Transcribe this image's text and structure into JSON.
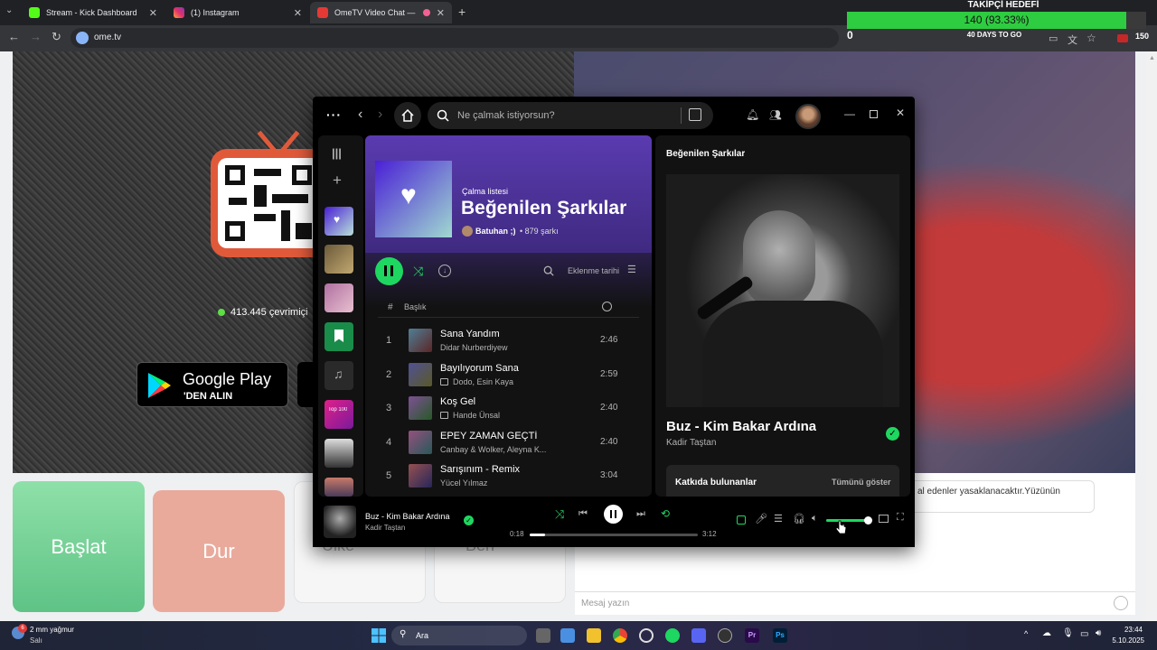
{
  "browser": {
    "tabs": [
      {
        "label": "Stream - Kick Dashboard",
        "color": "#53fc18"
      },
      {
        "label": "(1) Instagram",
        "color": "#e1306c"
      },
      {
        "label": "OmeTV Video Chat — Ome",
        "color": "#e53935"
      }
    ],
    "url": "ome.tv"
  },
  "goal": {
    "title": "TAKİPÇİ HEDEFİ",
    "progress_text": "140 (93.33%)",
    "progress_fraction": 0.9333,
    "start": "0",
    "end": "150",
    "days_text": "40 DAYS TO GO",
    "color": "#2ecc40"
  },
  "ometv": {
    "online_text": "413.445 çevrimiçi",
    "gplay_title": "Google Play",
    "gplay_sub": "'DEN ALIN",
    "start_label": "Başlat",
    "stop_label": "Dur",
    "card3_label": "Ülke",
    "card4_label": "Ben",
    "chat_notice": "al edenler yasaklanacaktır.Yüzünün",
    "chat_placeholder": "Mesaj yazın"
  },
  "spotify": {
    "search_placeholder": "Ne çalmak istiyorsun?",
    "playlist_type": "Çalma listesi",
    "playlist_title": "Beğenilen Şarkılar",
    "owner": "Batuhan ;)",
    "song_count": "• 879 şarkı",
    "sort_label": "Eklenme tarihi",
    "col_hash": "#",
    "col_title": "Başlık",
    "tracks": [
      {
        "num": "1",
        "title": "Sana Yandım",
        "artist": "Didar Nurberdiyew",
        "duration": "2:46",
        "video": false
      },
      {
        "num": "2",
        "title": "Bayılıyorum Sana",
        "artist": "Dodo, Esin Kaya",
        "duration": "2:59",
        "video": true
      },
      {
        "num": "3",
        "title": "Koş Gel",
        "artist": "Hande Ünsal",
        "duration": "2:40",
        "video": true
      },
      {
        "num": "4",
        "title": "EPEY ZAMAN GEÇTİ",
        "artist": "Canbay & Wolker, Aleyna K...",
        "duration": "2:40",
        "video": false
      },
      {
        "num": "5",
        "title": "Sarışınım - Remix",
        "artist": "Yücel Yılmaz",
        "duration": "3:04",
        "video": false
      }
    ],
    "np_header": "Beğenilen Şarkılar",
    "np_title": "Buz - Kim Bakar Ardına",
    "np_artist": "Kadir Taştan",
    "credits_label": "Katkıda bulunanlar",
    "show_all": "Tümünü göster",
    "bar_title": "Buz - Kim Bakar Ardına",
    "bar_artist": "Kadir Taştan",
    "time_elapsed": "0:18",
    "time_total": "3:12",
    "progress_fraction": 0.09,
    "volume_fraction": 0.95,
    "lib_thumb_label": "Top 100",
    "accent": "#1ed760"
  },
  "taskbar": {
    "weather_text": "2 mm yağmur",
    "weather_day": "Salı",
    "search_label": "Ara",
    "time": "23:44",
    "date": "5.10.2025",
    "notif_count": "6"
  }
}
